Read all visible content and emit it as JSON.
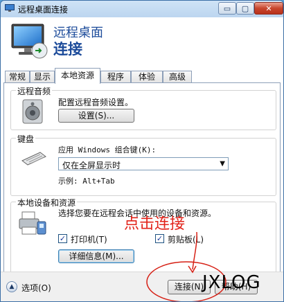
{
  "window": {
    "title": "远程桌面连接",
    "min_glyph": "▭",
    "max_glyph": "▢",
    "close_glyph": "✕"
  },
  "banner": {
    "line1": "远程桌面",
    "line2": "连接"
  },
  "tabs": [
    {
      "label": "常规",
      "active": false
    },
    {
      "label": "显示",
      "active": false
    },
    {
      "label": "本地资源",
      "active": true
    },
    {
      "label": "程序",
      "active": false
    },
    {
      "label": "体验",
      "active": false
    },
    {
      "label": "高级",
      "active": false
    }
  ],
  "audio": {
    "title": "远程音频",
    "description": "配置远程音频设置。",
    "settings_button": "设置(S)..."
  },
  "keyboard": {
    "title": "键盘",
    "apply_label": "应用 Windows 组合键(K):",
    "selected_option": "仅在全屏显示时",
    "dropdown_arrow": "▼",
    "example": "示例: Alt+Tab"
  },
  "devices": {
    "title": "本地设备和资源",
    "description": "选择您要在远程会话中使用的设备和资源。",
    "printers": {
      "label": "打印机(T)",
      "checked": true,
      "check_glyph": "✓"
    },
    "clipboard": {
      "label": "剪贴板(L)",
      "checked": true,
      "check_glyph": "✓"
    },
    "details_button": "详细信息(M)..."
  },
  "footer": {
    "options_glyph": "▲",
    "options_label": "选项(O)",
    "connect_button": "连接(N)",
    "help_button": "帮助(H)"
  },
  "annotation": {
    "text": "点击连接",
    "color": "#e2231a"
  },
  "watermark": "JXLOG"
}
